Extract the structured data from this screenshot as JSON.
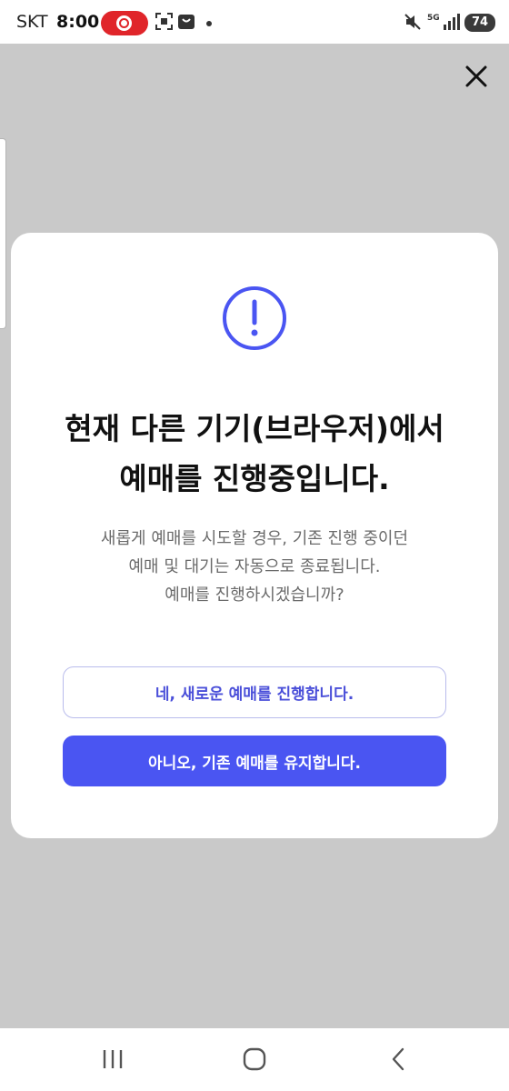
{
  "status_bar": {
    "carrier": "SKT",
    "time": "8:00",
    "network": "5G",
    "battery": "74"
  },
  "dialog": {
    "title_line1": "현재 다른 기기(브라우저)에서",
    "title_line2": "예매를 진행중입니다.",
    "desc_line1": "새롭게 예매를 시도할 경우, 기존 진행 중이던",
    "desc_line2": "예매 및 대기는 자동으로 종료됩니다.",
    "desc_line3": "예매를 진행하시겠습니까?",
    "confirm_label": "네, 새로운 예매를 진행합니다.",
    "cancel_label": "아니오, 기존 예매를 유지합니다."
  },
  "icons": {
    "close": "close-icon",
    "alert": "exclamation-circle-icon",
    "recent_apps": "recent-apps-icon",
    "home": "home-icon",
    "back": "back-icon"
  },
  "colors": {
    "accent": "#4a55f2",
    "overlay": "#c9c9c9",
    "recording": "#e0252a"
  }
}
